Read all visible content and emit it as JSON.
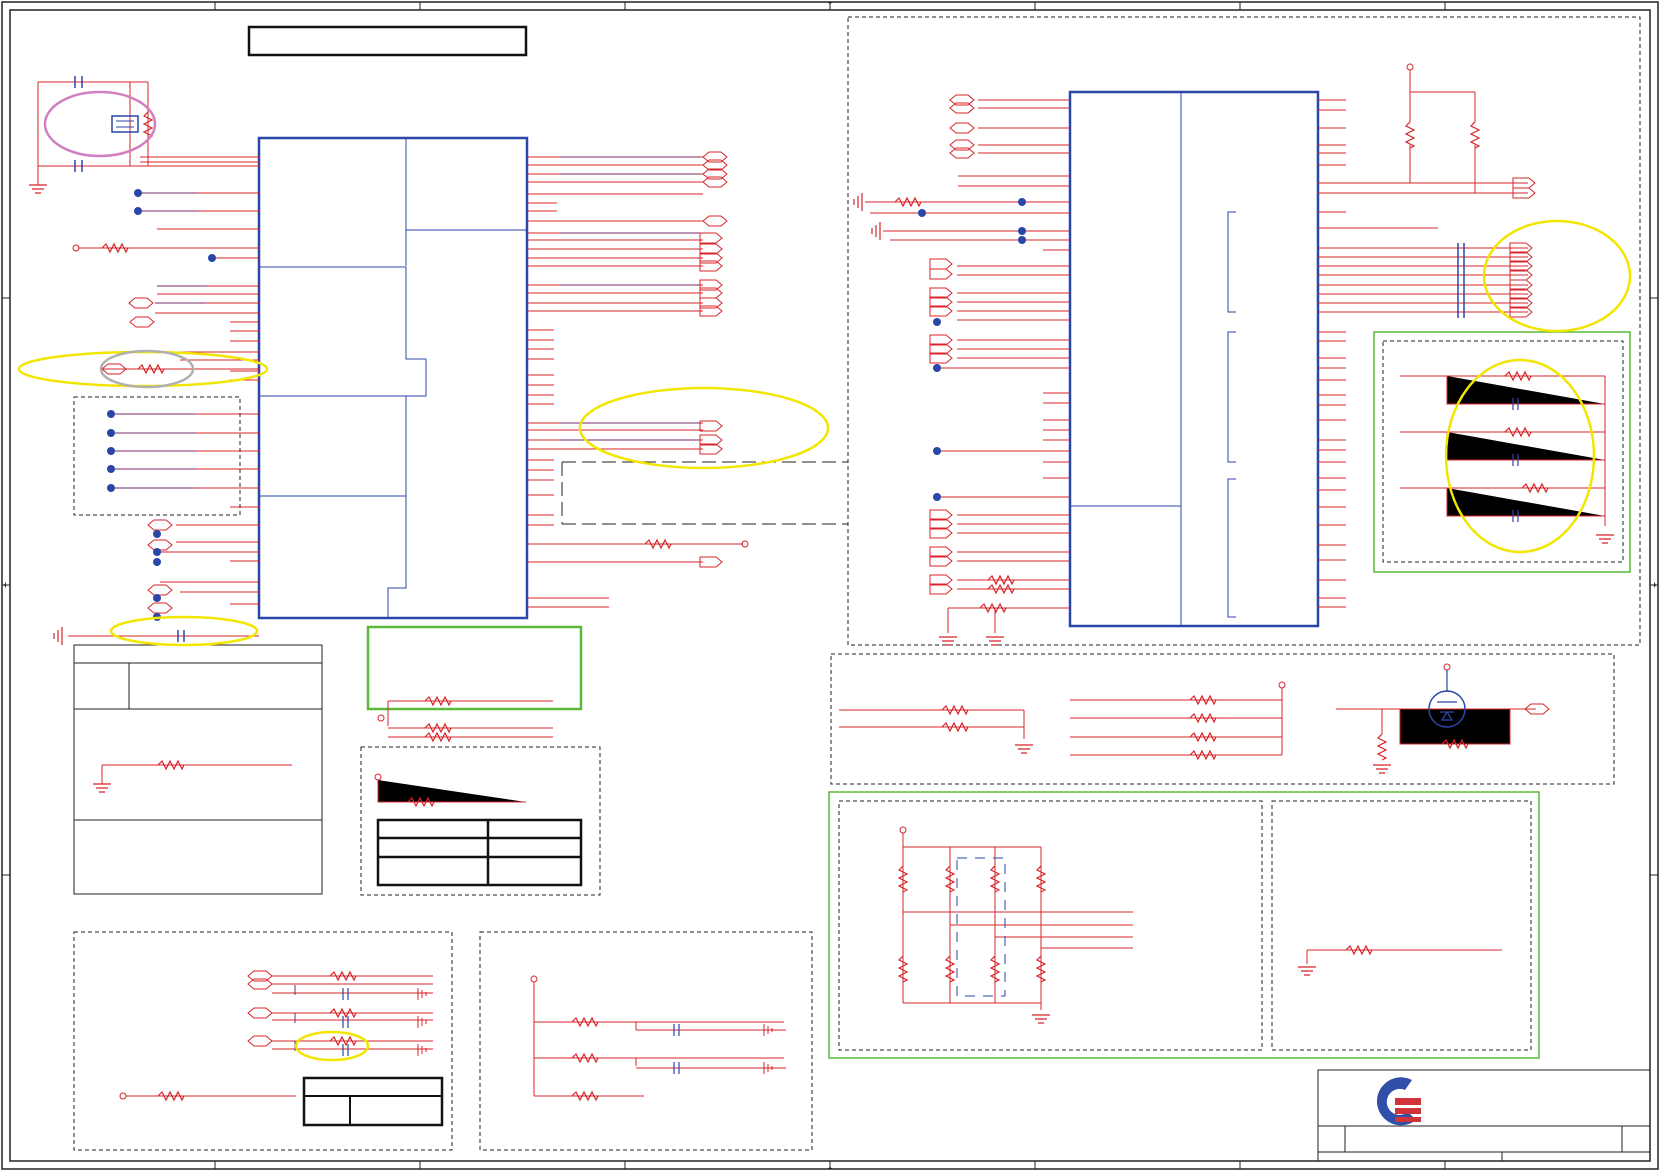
{
  "sheet": {
    "title_box_text": "",
    "logo": {
      "name": "company-logo-icon",
      "blue": "#2f4fa8",
      "red": "#d0343a"
    }
  },
  "colors": {
    "wire": "#d8232a",
    "net": "#7a2a6a",
    "component": "#2a47a8",
    "dashed_border": "#222222",
    "highlight_yellow": "#f2e600",
    "highlight_green": "#5cb83a",
    "highlight_pink": "#d080c0",
    "highlight_gray": "#b0b0b0",
    "junction_dot": "#2a47a8"
  },
  "notes": "",
  "table_1": {
    "rows": [
      "",
      ""
    ],
    "cols": [
      "",
      ""
    ]
  },
  "table_2": {
    "cols": [
      "",
      ""
    ]
  }
}
